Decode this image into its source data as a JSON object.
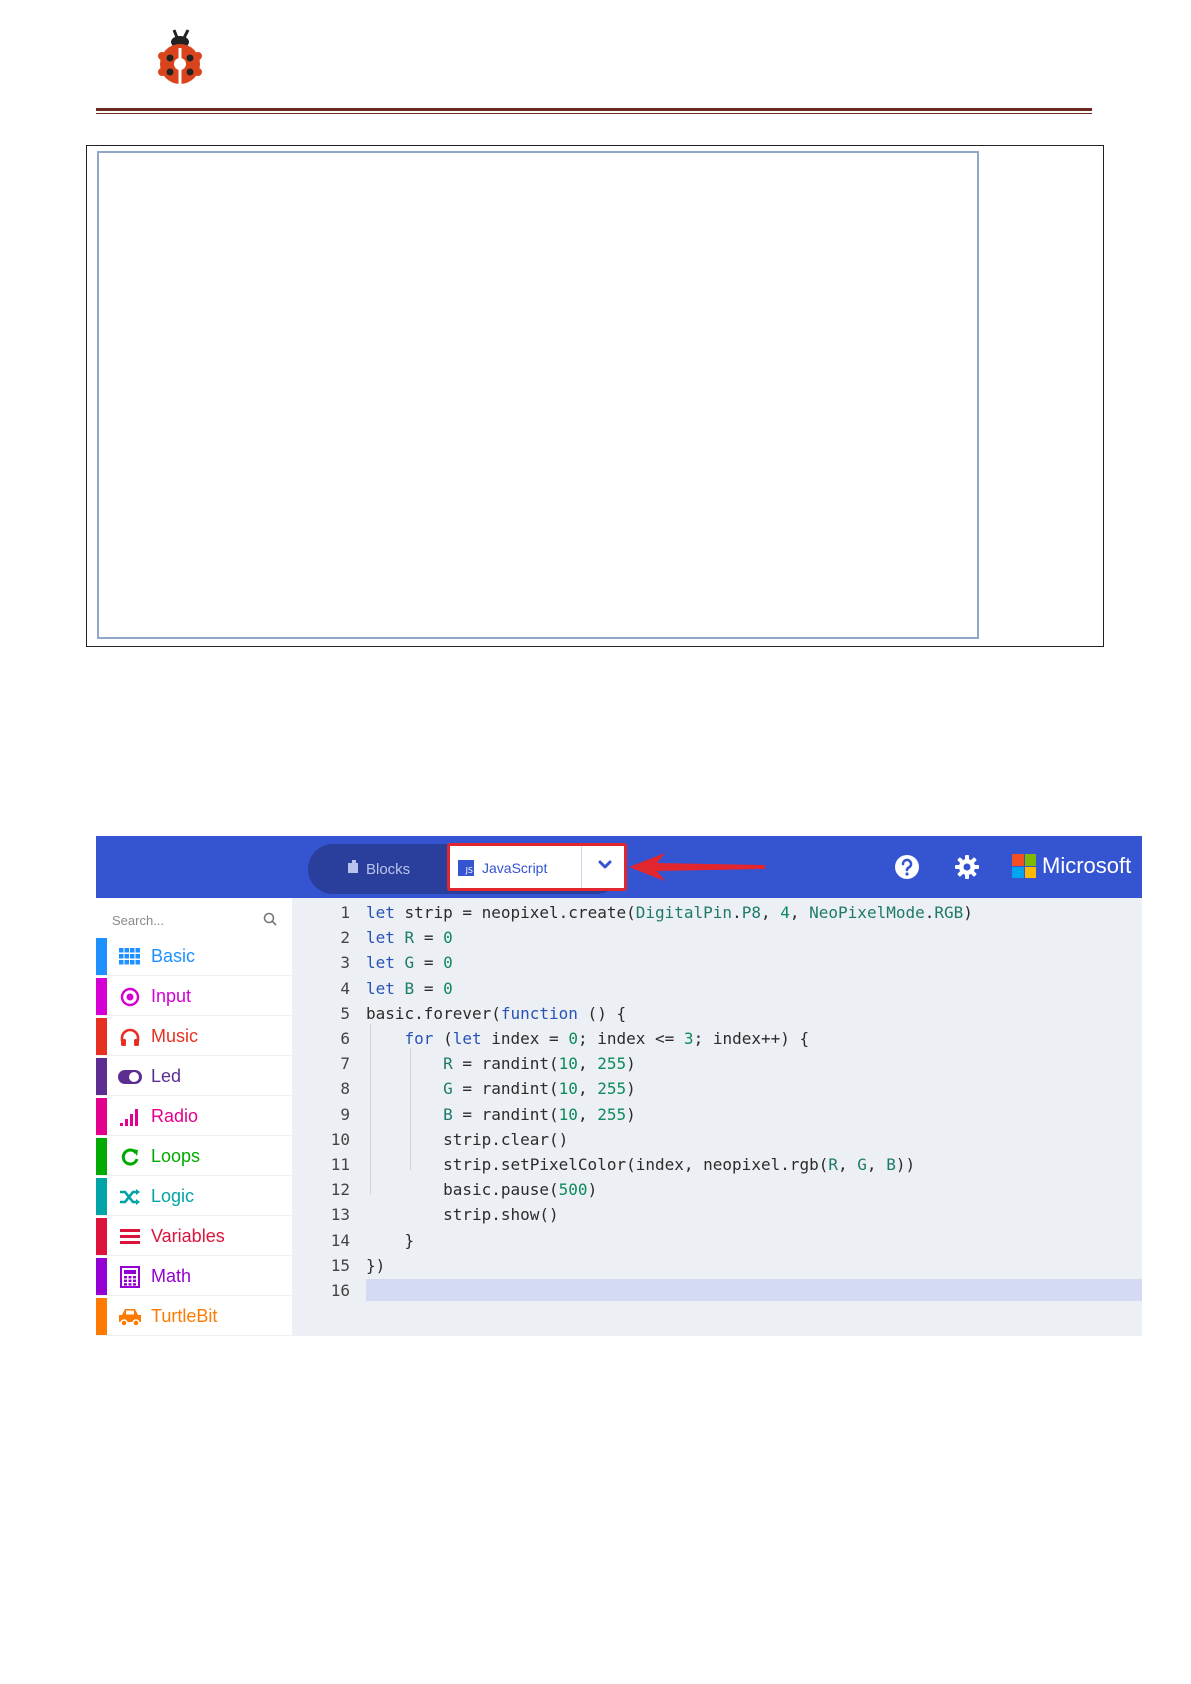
{
  "doc": {
    "logo_icon": "ladybug-icon",
    "header_color": "#6b2a1e"
  },
  "editor": {
    "toolbar": {
      "blocks_label": "Blocks",
      "javascript_label": "JavaScript",
      "js_badge": "JS",
      "brand": "Microsoft",
      "accent": "#3454d1",
      "highlight": "#e2262d"
    },
    "search": {
      "placeholder": "Search..."
    },
    "categories": [
      {
        "label": "Basic",
        "color": "#1e90ff",
        "icon": "grid-icon"
      },
      {
        "label": "Input",
        "color": "#d400d4",
        "icon": "target-icon"
      },
      {
        "label": "Music",
        "color": "#e63022",
        "icon": "headphones-icon"
      },
      {
        "label": "Led",
        "color": "#5c2d91",
        "icon": "toggle-icon"
      },
      {
        "label": "Radio",
        "color": "#e3008c",
        "icon": "signal-bars-icon"
      },
      {
        "label": "Loops",
        "color": "#00aa00",
        "icon": "refresh-icon"
      },
      {
        "label": "Logic",
        "color": "#00a4a6",
        "icon": "shuffle-icon"
      },
      {
        "label": "Variables",
        "color": "#dc143c",
        "icon": "list-icon"
      },
      {
        "label": "Math",
        "color": "#9400d3",
        "icon": "calculator-icon"
      },
      {
        "label": "TurtleBit",
        "color": "#ff7a00",
        "icon": "car-icon"
      }
    ],
    "code_lines": [
      {
        "n": "1",
        "html": "<span class='kw'>let</span> strip = neopixel.create(<span class='nm'>DigitalPin</span>.<span class='nm'>P8</span>, <span class='num'>4</span>, <span class='nm'>NeoPixelMode</span>.<span class='nm'>RGB</span>)"
      },
      {
        "n": "2",
        "html": "<span class='kw'>let</span> <span class='nm'>R</span> = <span class='num'>0</span>"
      },
      {
        "n": "3",
        "html": "<span class='kw'>let</span> <span class='nm'>G</span> = <span class='num'>0</span>"
      },
      {
        "n": "4",
        "html": "<span class='kw'>let</span> <span class='nm'>B</span> = <span class='num'>0</span>"
      },
      {
        "n": "5",
        "html": "basic.forever(<span class='kw'>function</span> () {"
      },
      {
        "n": "6",
        "html": "    <span class='kw'>for</span> (<span class='kw'>let</span> index = <span class='num'>0</span>; index &lt;= <span class='num'>3</span>; index++) {"
      },
      {
        "n": "7",
        "html": "        <span class='nm'>R</span> = randint(<span class='num'>10</span>, <span class='num'>255</span>)"
      },
      {
        "n": "8",
        "html": "        <span class='nm'>G</span> = randint(<span class='num'>10</span>, <span class='num'>255</span>)"
      },
      {
        "n": "9",
        "html": "        <span class='nm'>B</span> = randint(<span class='num'>10</span>, <span class='num'>255</span>)"
      },
      {
        "n": "10",
        "html": "        strip.clear()"
      },
      {
        "n": "11",
        "html": "        strip.setPixelColor(index, neopixel.rgb(<span class='nm'>R</span>, <span class='nm'>G</span>, <span class='nm'>B</span>))"
      },
      {
        "n": "12",
        "html": "        basic.pause(<span class='num'>500</span>)"
      },
      {
        "n": "13",
        "html": "        strip.show()"
      },
      {
        "n": "14",
        "html": "    }"
      },
      {
        "n": "15",
        "html": "})"
      },
      {
        "n": "16",
        "html": ""
      }
    ]
  }
}
